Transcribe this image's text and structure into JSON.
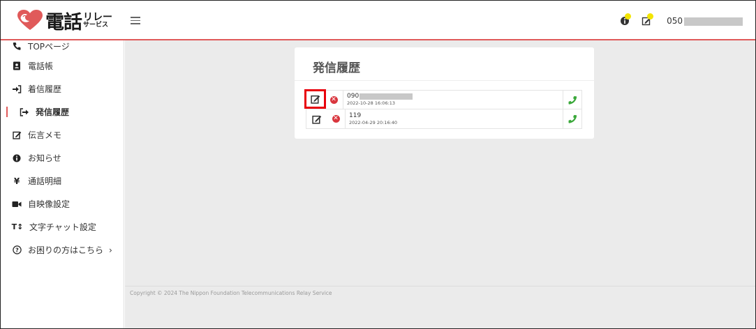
{
  "header": {
    "logo_main": "電話",
    "logo_sub_top": "リレー",
    "logo_sub_bottom": "サービス",
    "phone_prefix": "050"
  },
  "sidebar": {
    "items": [
      {
        "label": "TOPページ",
        "icon": "phone-icon"
      },
      {
        "label": "電話帳",
        "icon": "address-book-icon"
      },
      {
        "label": "着信履歴",
        "icon": "incoming-icon"
      },
      {
        "label": "発信履歴",
        "icon": "outgoing-icon",
        "active": true
      },
      {
        "label": "伝言メモ",
        "icon": "memo-edit-icon"
      },
      {
        "label": "お知らせ",
        "icon": "info-icon"
      },
      {
        "label": "通話明細",
        "icon": "yen-icon"
      },
      {
        "label": "自映像設定",
        "icon": "video-icon"
      },
      {
        "label": "文字チャット設定",
        "icon": "text-size-icon"
      },
      {
        "label": "お困りの方はこちら",
        "icon": "help-icon",
        "chevron": "›"
      }
    ]
  },
  "main": {
    "title": "発信履歴",
    "history": [
      {
        "number": "090",
        "masked": true,
        "datetime": "2022-10-28 16:06:13",
        "edit_highlighted": true
      },
      {
        "number": "119",
        "masked": false,
        "datetime": "2022-04-29 20:16:40",
        "edit_highlighted": false
      }
    ]
  },
  "footer": {
    "copyright": "Copyright © 2024 The Nippon Foundation Telecommunications Relay Service"
  },
  "colors": {
    "brand_red": "#e05a5a",
    "highlight_red": "#e8000b",
    "call_green": "#3aa83a",
    "delete_red": "#d9363e",
    "badge_yellow": "#f3e500"
  }
}
